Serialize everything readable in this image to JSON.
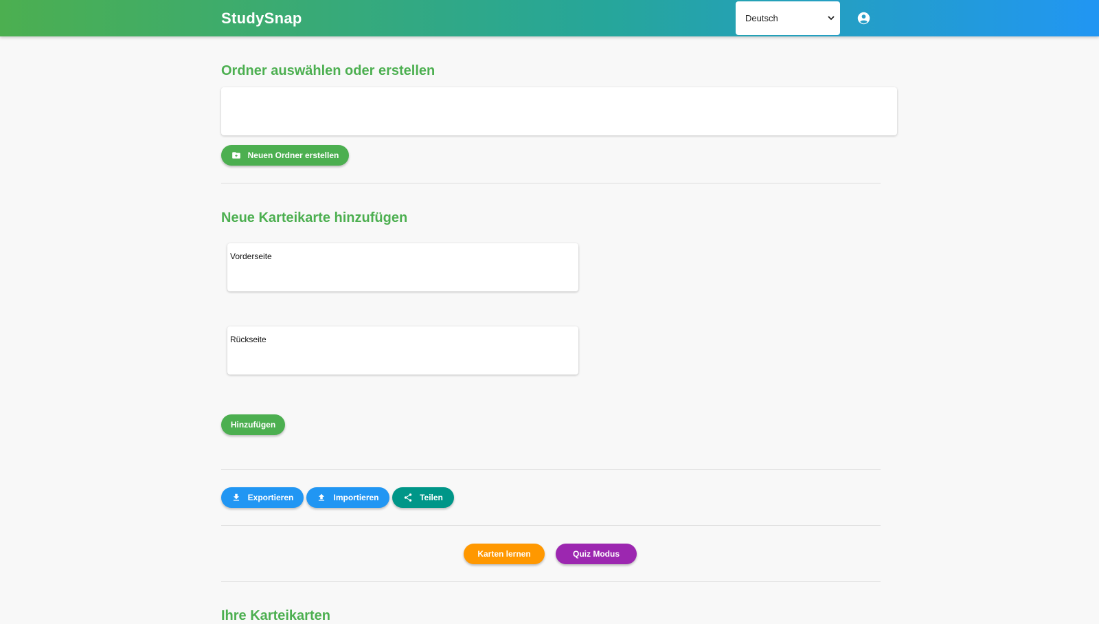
{
  "header": {
    "app_title": "StudySnap",
    "language": {
      "selected": "Deutsch"
    },
    "icons": {
      "account": "account-circle-icon",
      "dropdown": "chevron-down-icon"
    }
  },
  "folders": {
    "title": "Ordner auswählen oder erstellen",
    "create_button": "Neuen Ordner erstellen"
  },
  "new_card": {
    "title": "Neue Karteikarte hinzufügen",
    "front_label": "Vorderseite",
    "back_label": "Rückseite",
    "add_button": "Hinzufügen"
  },
  "actions": {
    "export": "Exportieren",
    "import": "Importieren",
    "share": "Teilen"
  },
  "modes": {
    "learn": "Karten lernen",
    "quiz": "Quiz Modus"
  },
  "cards_list": {
    "title": "Ihre Karteikarten"
  },
  "colors": {
    "primary_green": "#4caf50",
    "primary_blue": "#2196f3",
    "teal": "#009688",
    "orange": "#ff9800",
    "purple": "#9c27b0"
  }
}
